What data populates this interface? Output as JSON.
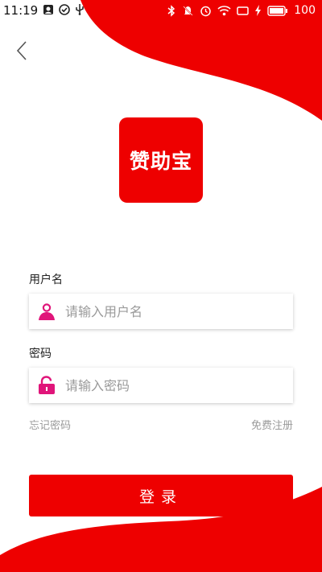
{
  "status_bar": {
    "time": "11:19",
    "battery": "100"
  },
  "app": {
    "logo_text": "赞助宝",
    "brand_color": "#ee0000"
  },
  "form": {
    "username_label": "用户名",
    "username_placeholder": "请输入用户名",
    "password_label": "密码",
    "password_placeholder": "请输入密码",
    "icon_color": "#e0157a"
  },
  "links": {
    "forgot_password": "忘记密码",
    "register": "免费注册"
  },
  "login_button": "登录"
}
